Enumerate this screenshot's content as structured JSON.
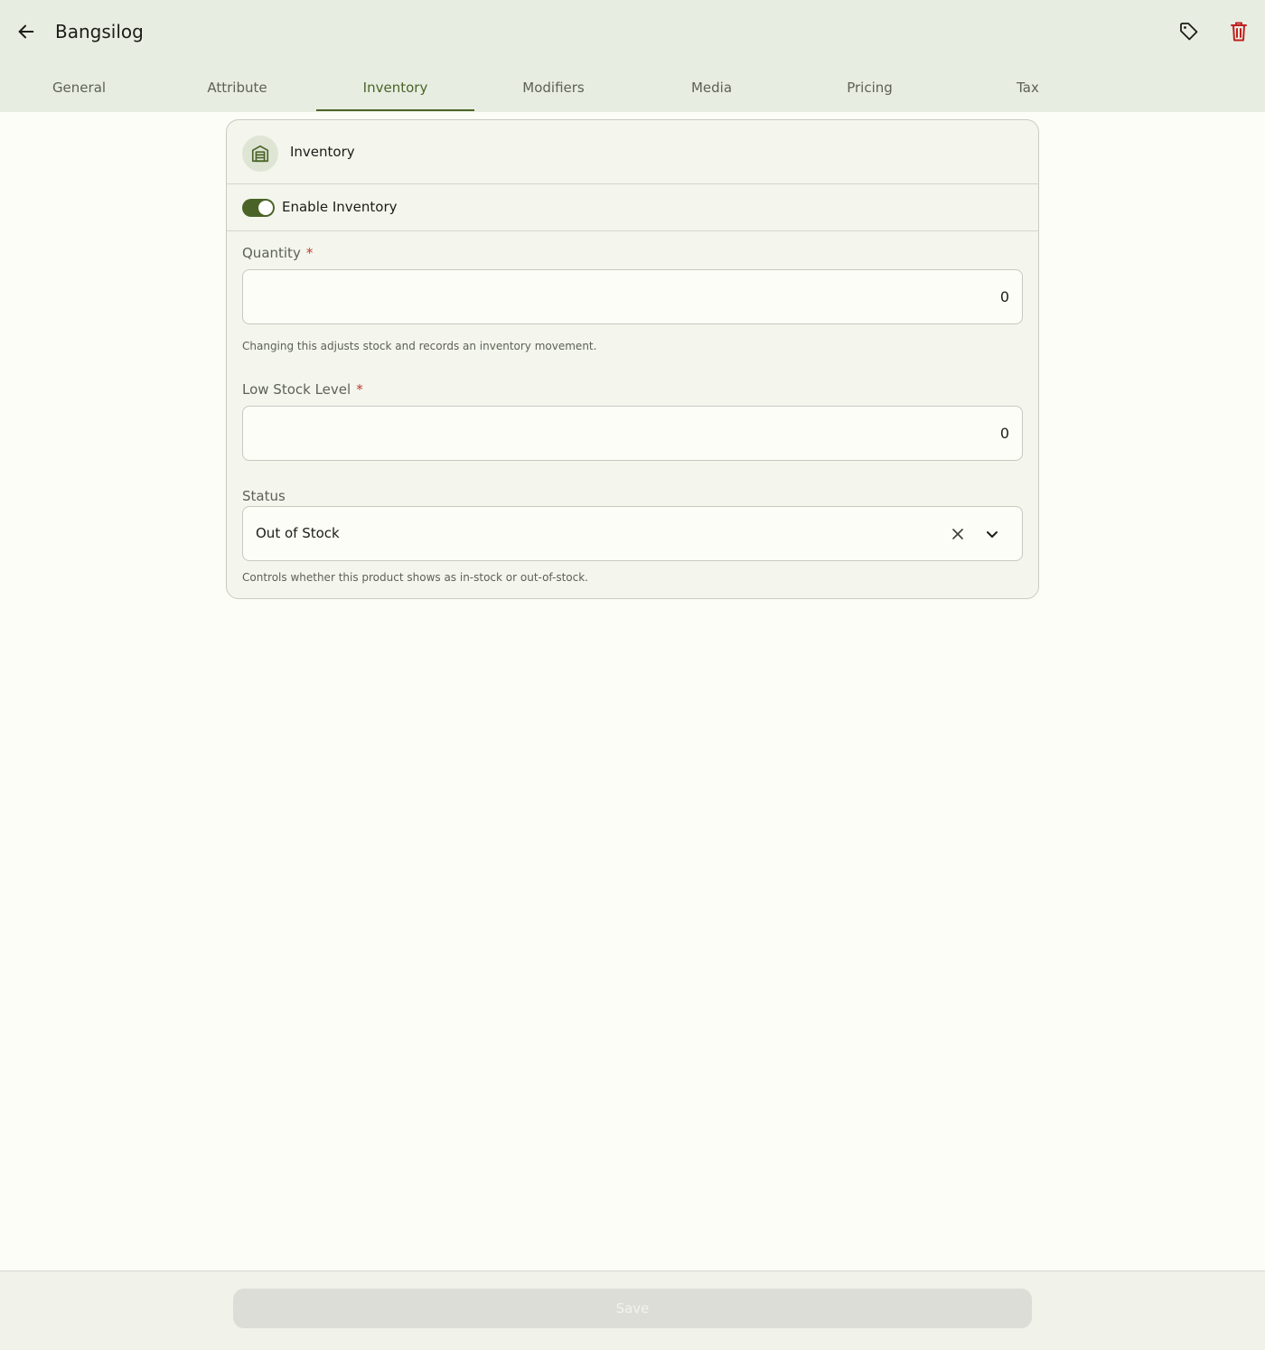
{
  "header": {
    "title": "Bangsilog",
    "back_icon": "arrow-left-icon",
    "tag_icon": "tag-icon",
    "delete_icon": "trash-icon",
    "delete_color": "#c0201f"
  },
  "tabs": [
    {
      "label": "General"
    },
    {
      "label": "Attribute"
    },
    {
      "label": "Inventory",
      "active": true
    },
    {
      "label": "Modifiers"
    },
    {
      "label": "Media"
    },
    {
      "label": "Pricing"
    },
    {
      "label": "Tax"
    }
  ],
  "inventory_card": {
    "title": "Inventory",
    "icon": "warehouse-icon",
    "toggle": {
      "label": "Enable Inventory",
      "enabled": true
    },
    "quantity": {
      "label": "Quantity",
      "required_mark": "*",
      "value": "0",
      "hint": "Changing this adjusts stock and records an inventory movement."
    },
    "low_stock": {
      "label": "Low Stock Level",
      "required_mark": "*",
      "value": "0"
    },
    "status": {
      "label": "Status",
      "value": "Out of Stock",
      "hint": "Controls whether this product shows as in-stock or out-of-stock."
    }
  },
  "footer": {
    "save_label": "Save",
    "save_disabled": true
  },
  "colors": {
    "accent": "#4a6428",
    "header_bg": "#e8ede1",
    "required": "#c0392b"
  }
}
